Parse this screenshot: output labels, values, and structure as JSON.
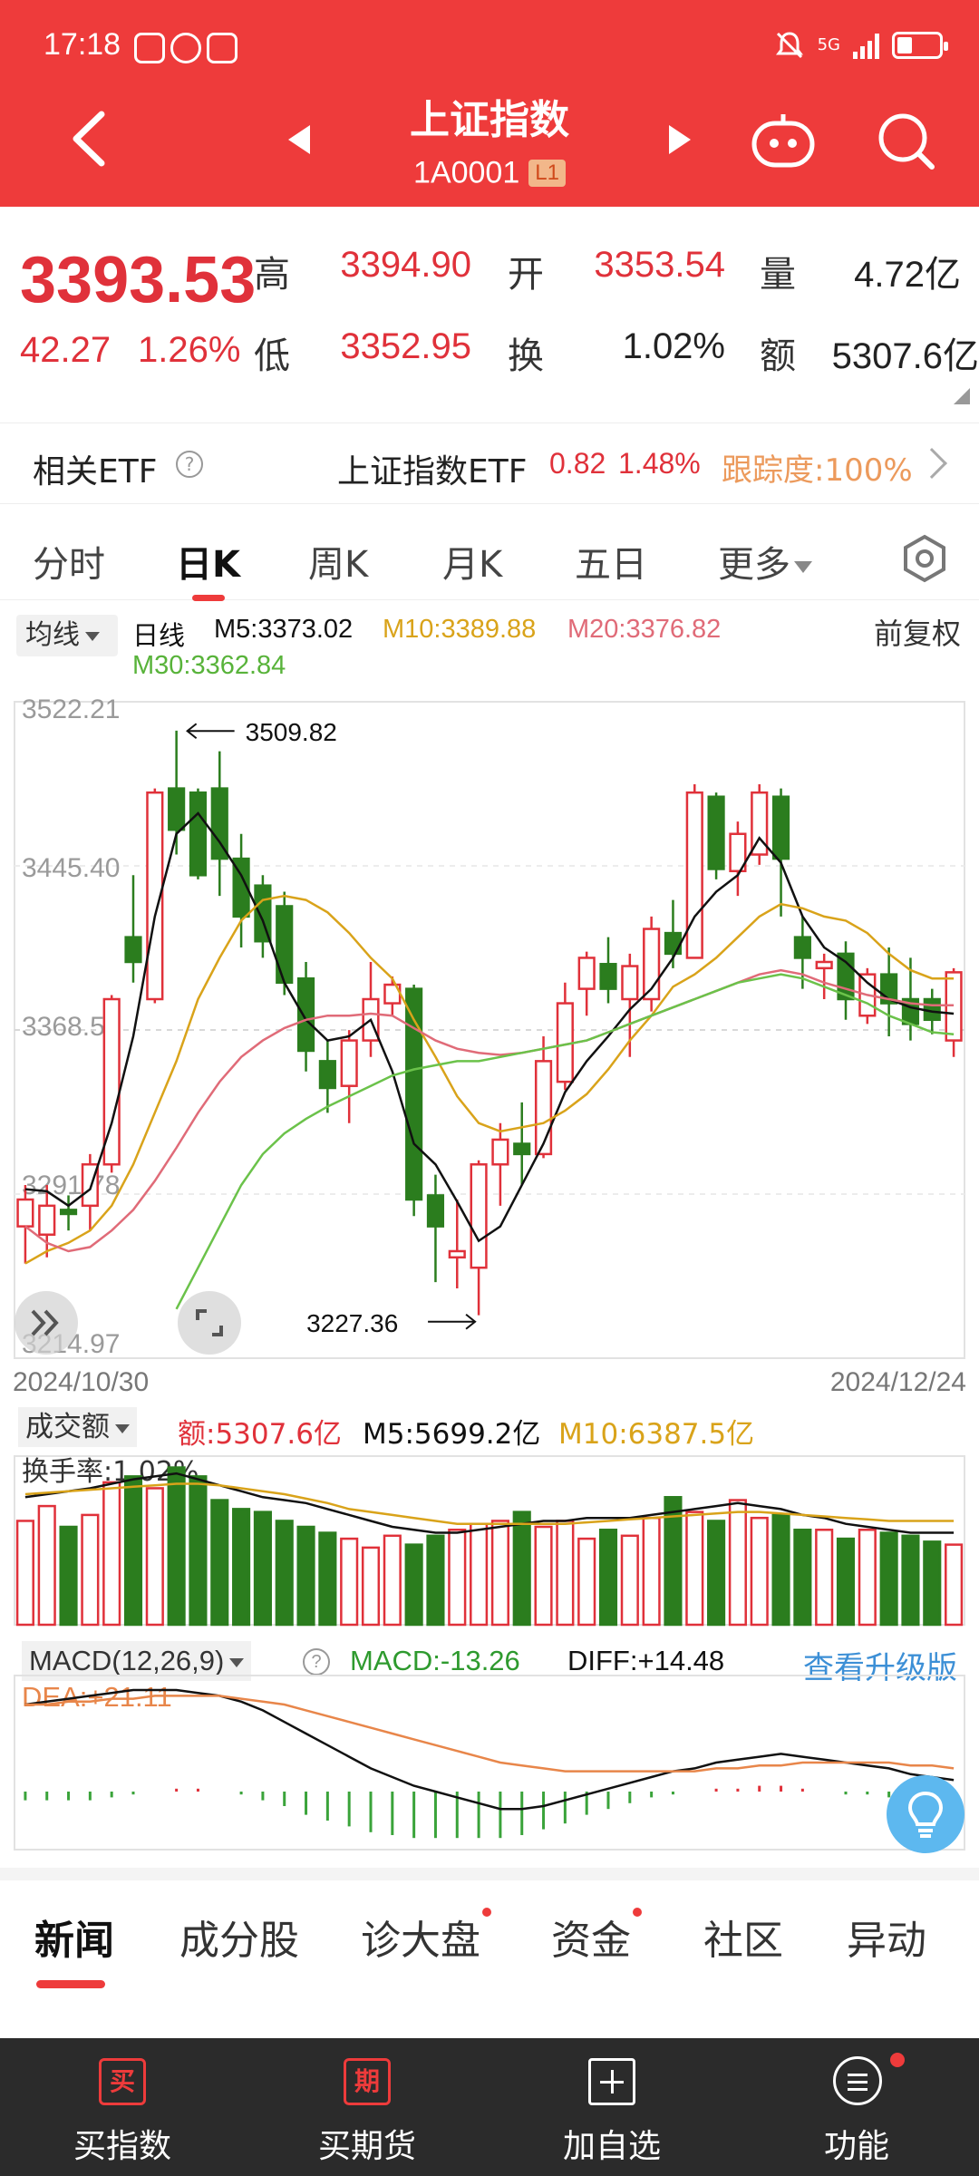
{
  "status": {
    "time": "17:18",
    "network": "5G",
    "colors": {
      "bar": "#ee3b3b"
    }
  },
  "header": {
    "title": "上证指数",
    "code": "1A0001",
    "level_badge": "L1",
    "icons": [
      "back-icon",
      "prev-icon",
      "next-icon",
      "robot-icon",
      "search-icon"
    ]
  },
  "quote": {
    "price": "3393.53",
    "change": "42.27",
    "change_pct": "1.26%",
    "high_label": "高",
    "high": "3394.90",
    "open_label": "开",
    "open": "3353.54",
    "volume_label": "量",
    "volume": "4.72亿",
    "low_label": "低",
    "low": "3352.95",
    "turnover_label": "换",
    "turnover": "1.02%",
    "amount_label": "额",
    "amount": "5307.6亿"
  },
  "etf": {
    "label": "相关ETF",
    "help_icon": "?",
    "name": "上证指数ETF",
    "price": "0.82",
    "change_pct": "1.48%",
    "tracking": "跟踪度:100%"
  },
  "tabs": {
    "items": [
      "分时",
      "日K",
      "周K",
      "月K",
      "五日",
      "更多"
    ],
    "active": "日K"
  },
  "kline_legend": {
    "selector": "均线",
    "period": "日线",
    "m5": "M5:3373.02",
    "m10": "M10:3389.88",
    "m20": "M20:3376.82",
    "m30": "M30:3362.84",
    "adjust": "前复权",
    "colors": {
      "m5": "#111111",
      "m10": "#d9a31a",
      "m20": "#e06b78",
      "m30": "#6bc24a"
    }
  },
  "dates": {
    "start": "2024/10/30",
    "end": "2024/12/24"
  },
  "volume_legend": {
    "selector": "成交额",
    "amount": "额:5307.6亿",
    "m5": "M5:5699.2亿",
    "m10": "M10:6387.5亿",
    "turnover": "换手率:1.02%"
  },
  "macd_legend": {
    "selector": "MACD(12,26,9)",
    "macd": "MACD:-13.26",
    "diff": "DIFF:+14.48",
    "dea": "DEA:+21.11",
    "upgrade": "查看升级版"
  },
  "news_tabs": {
    "items": [
      "新闻",
      "成分股",
      "诊大盘",
      "资金",
      "社区",
      "异动"
    ],
    "active": "新闻"
  },
  "bottom_nav": {
    "items": [
      {
        "icon_text": "买",
        "label": "买指数"
      },
      {
        "icon_text": "期",
        "label": "买期货"
      },
      {
        "icon_text": "",
        "label": "加自选"
      },
      {
        "icon_text": "",
        "label": "功能"
      }
    ]
  },
  "chart_data": {
    "type": "candlestick",
    "y_ticks": [
      "3522.21",
      "3445.40",
      "3368.59",
      "3291.78",
      "3214.97"
    ],
    "ylim": [
      3214.97,
      3522.21
    ],
    "annotations": [
      {
        "text": "3509.82",
        "value": 3509.82
      },
      {
        "text": "3227.36",
        "value": 3227.36
      }
    ],
    "candles": [
      [
        3270,
        3283,
        3252,
        3290
      ],
      [
        3266,
        3280,
        3255,
        3290
      ],
      [
        3278,
        3276,
        3268,
        3285
      ],
      [
        3280,
        3300,
        3268,
        3305
      ],
      [
        3300,
        3380,
        3296,
        3382
      ],
      [
        3410,
        3398,
        3388,
        3440
      ],
      [
        3380,
        3480,
        3378,
        3482
      ],
      [
        3482,
        3462,
        3450,
        3510
      ],
      [
        3480,
        3440,
        3438,
        3482
      ],
      [
        3482,
        3448,
        3430,
        3500
      ],
      [
        3448,
        3420,
        3405,
        3460
      ],
      [
        3435,
        3408,
        3400,
        3440
      ],
      [
        3425,
        3388,
        3382,
        3432
      ],
      [
        3390,
        3355,
        3345,
        3398
      ],
      [
        3350,
        3337,
        3325,
        3360
      ],
      [
        3338,
        3360,
        3320,
        3365
      ],
      [
        3360,
        3380,
        3352,
        3398
      ],
      [
        3378,
        3387,
        3372,
        3391
      ],
      [
        3385,
        3283,
        3275,
        3387
      ],
      [
        3285,
        3270,
        3243,
        3295
      ],
      [
        3255,
        3258,
        3240,
        3283
      ],
      [
        3250,
        3300,
        3227,
        3302
      ],
      [
        3300,
        3312,
        3280,
        3320
      ],
      [
        3310,
        3305,
        3290,
        3330
      ],
      [
        3305,
        3350,
        3303,
        3362
      ],
      [
        3340,
        3378,
        3336,
        3388
      ],
      [
        3385,
        3400,
        3372,
        3403
      ],
      [
        3397,
        3385,
        3378,
        3410
      ],
      [
        3380,
        3396,
        3352,
        3402
      ],
      [
        3380,
        3414,
        3374,
        3420
      ],
      [
        3412,
        3402,
        3395,
        3428
      ],
      [
        3400,
        3480,
        3400,
        3484
      ],
      [
        3478,
        3443,
        3438,
        3480
      ],
      [
        3442,
        3460,
        3430,
        3466
      ],
      [
        3450,
        3480,
        3445,
        3484
      ],
      [
        3478,
        3448,
        3420,
        3482
      ],
      [
        3410,
        3400,
        3385,
        3420
      ],
      [
        3395,
        3398,
        3380,
        3402
      ],
      [
        3402,
        3380,
        3370,
        3408
      ],
      [
        3372,
        3392,
        3368,
        3395
      ],
      [
        3392,
        3378,
        3362,
        3405
      ],
      [
        3380,
        3368,
        3360,
        3400
      ],
      [
        3380,
        3370,
        3363,
        3385
      ],
      [
        3360,
        3393,
        3352,
        3395
      ]
    ],
    "series": [
      {
        "name": "M5",
        "values": [
          3288,
          3287,
          3280,
          3288,
          3320,
          3362,
          3420,
          3460,
          3470,
          3456,
          3440,
          3418,
          3388,
          3370,
          3360,
          3362,
          3370,
          3345,
          3310,
          3300,
          3282,
          3263,
          3270,
          3290,
          3310,
          3335,
          3350,
          3362,
          3375,
          3385,
          3400,
          3420,
          3432,
          3440,
          3458,
          3446,
          3420,
          3405,
          3398,
          3388,
          3380,
          3376,
          3374,
          3373
        ]
      },
      {
        "name": "M10",
        "values": [
          3252,
          3258,
          3262,
          3268,
          3280,
          3300,
          3325,
          3350,
          3380,
          3400,
          3418,
          3428,
          3430,
          3428,
          3422,
          3412,
          3400,
          3390,
          3370,
          3352,
          3333,
          3320,
          3316,
          3318,
          3320,
          3326,
          3334,
          3346,
          3360,
          3372,
          3386,
          3392,
          3400,
          3410,
          3420,
          3426,
          3424,
          3420,
          3418,
          3412,
          3402,
          3394,
          3390,
          3390
        ]
      },
      {
        "name": "M20",
        "values": [
          3270,
          3262,
          3258,
          3260,
          3268,
          3278,
          3292,
          3308,
          3325,
          3340,
          3352,
          3360,
          3366,
          3370,
          3372,
          3372,
          3373,
          3372,
          3366,
          3360,
          3356,
          3354,
          3353,
          3354,
          3356,
          3358,
          3360,
          3364,
          3368,
          3372,
          3376,
          3380,
          3384,
          3388,
          3392,
          3394,
          3392,
          3388,
          3385,
          3382,
          3380,
          3378,
          3377,
          3377
        ]
      },
      {
        "name": "M30",
        "values": [
          null,
          null,
          null,
          null,
          null,
          null,
          null,
          3230,
          3250,
          3270,
          3290,
          3305,
          3315,
          3322,
          3328,
          3333,
          3338,
          3343,
          3346,
          3348,
          3350,
          3350,
          3352,
          3354,
          3356,
          3358,
          3360,
          3364,
          3368,
          3372,
          3376,
          3380,
          3384,
          3388,
          3390,
          3392,
          3390,
          3386,
          3382,
          3378,
          3372,
          3368,
          3364,
          3363
        ]
      }
    ],
    "volume": {
      "values": [
        0.7,
        0.8,
        0.66,
        0.74,
        0.96,
        1.0,
        0.92,
        1.06,
        1.0,
        0.84,
        0.78,
        0.76,
        0.7,
        0.66,
        0.62,
        0.58,
        0.52,
        0.6,
        0.54,
        0.6,
        0.64,
        0.68,
        0.7,
        0.76,
        0.66,
        0.7,
        0.58,
        0.64,
        0.6,
        0.72,
        0.86,
        0.76,
        0.7,
        0.84,
        0.72,
        0.74,
        0.64,
        0.64,
        0.58,
        0.64,
        0.62,
        0.6,
        0.56,
        0.54
      ],
      "m5": [
        0.86,
        0.88,
        0.9,
        0.92,
        0.95,
        0.98,
        1.0,
        1.02,
        0.98,
        0.94,
        0.9,
        0.86,
        0.84,
        0.82,
        0.78,
        0.74,
        0.7,
        0.66,
        0.64,
        0.62,
        0.62,
        0.64,
        0.66,
        0.68,
        0.7,
        0.7,
        0.72,
        0.72,
        0.72,
        0.74,
        0.76,
        0.78,
        0.8,
        0.82,
        0.8,
        0.78,
        0.74,
        0.72,
        0.68,
        0.66,
        0.64,
        0.62,
        0.62,
        0.62
      ],
      "m10": [
        0.88,
        0.89,
        0.9,
        0.91,
        0.92,
        0.93,
        0.94,
        0.95,
        0.95,
        0.94,
        0.92,
        0.9,
        0.88,
        0.85,
        0.82,
        0.78,
        0.76,
        0.74,
        0.72,
        0.7,
        0.68,
        0.68,
        0.68,
        0.68,
        0.68,
        0.68,
        0.69,
        0.7,
        0.71,
        0.72,
        0.73,
        0.74,
        0.75,
        0.76,
        0.76,
        0.75,
        0.74,
        0.73,
        0.72,
        0.71,
        0.7,
        0.7,
        0.7,
        0.7
      ],
      "ymax": 1.1
    },
    "macd": {
      "diff": [
        30,
        31,
        32,
        33,
        34,
        35,
        35,
        35,
        34,
        33,
        31,
        28,
        24,
        20,
        16,
        12,
        8,
        5,
        2,
        0,
        -2,
        -4,
        -6,
        -6,
        -5,
        -3,
        -1,
        1,
        3,
        5,
        7,
        8,
        10,
        11,
        12,
        13,
        12,
        11,
        10,
        9,
        8,
        6,
        5,
        4
      ],
      "dea": [
        30,
        30,
        31,
        31,
        32,
        32,
        33,
        33,
        33,
        33,
        32,
        31,
        30,
        28,
        26,
        24,
        22,
        20,
        18,
        16,
        14,
        12,
        10,
        9,
        8,
        7,
        7,
        7,
        7,
        7,
        7,
        7,
        8,
        8,
        9,
        9,
        10,
        10,
        10,
        10,
        10,
        9,
        9,
        8
      ],
      "hist": [
        -3,
        -3,
        -3,
        -3,
        -2,
        -1,
        0,
        1,
        1,
        0,
        -1,
        -3,
        -5,
        -8,
        -10,
        -12,
        -14,
        -15,
        -16,
        -16,
        -16,
        -16,
        -16,
        -15,
        -13,
        -11,
        -8,
        -6,
        -4,
        -2,
        -1,
        0,
        1,
        1,
        2,
        2,
        1,
        0,
        -1,
        -1,
        -2,
        -3,
        -3,
        -4
      ],
      "ylim": [
        -20,
        40
      ]
    }
  }
}
